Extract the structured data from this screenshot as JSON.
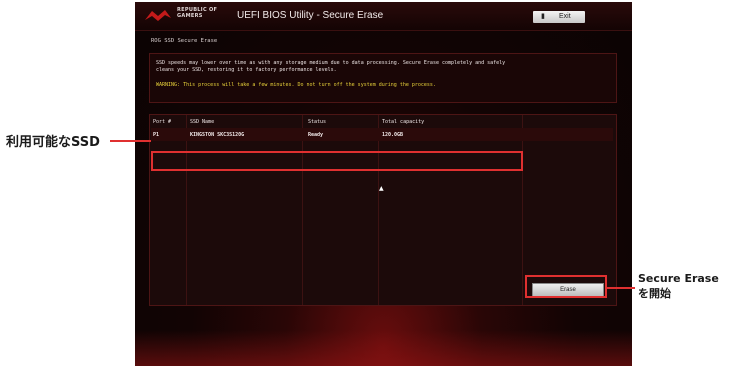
{
  "window": {
    "brand_line1": "REPUBLIC OF",
    "brand_line2": "GAMERS",
    "title": "UEFI BIOS Utility - Secure Erase",
    "exit_label": "Exit",
    "exit_icon": "exit-door-icon"
  },
  "breadcrumb": "ROG SSD Secure Erase",
  "message": {
    "line1": "SSD speeds may lower over time as with any storage medium due to data processing. Secure Erase completely and safely",
    "line2": "cleans your SSD, restoring it to factory performance levels.",
    "warning": "WARNING: This process will take a few minutes. Do not turn off the system during the process."
  },
  "table": {
    "headers": [
      "Port #",
      "SSD Name",
      "Status",
      "Total capacity"
    ],
    "rows": [
      [
        "P1",
        "KINGSTON SKC3S120G",
        "Ready",
        "120.0GB"
      ]
    ]
  },
  "buttons": {
    "erase": "Erase"
  },
  "annotations": {
    "available_ssd": "利用可能なSSD",
    "secure_erase_line1": "Secure Erase",
    "secure_erase_line2": "を開始"
  },
  "colors": {
    "highlight": "#e03030",
    "warning_text": "#e8d23a",
    "background": "#120404"
  }
}
